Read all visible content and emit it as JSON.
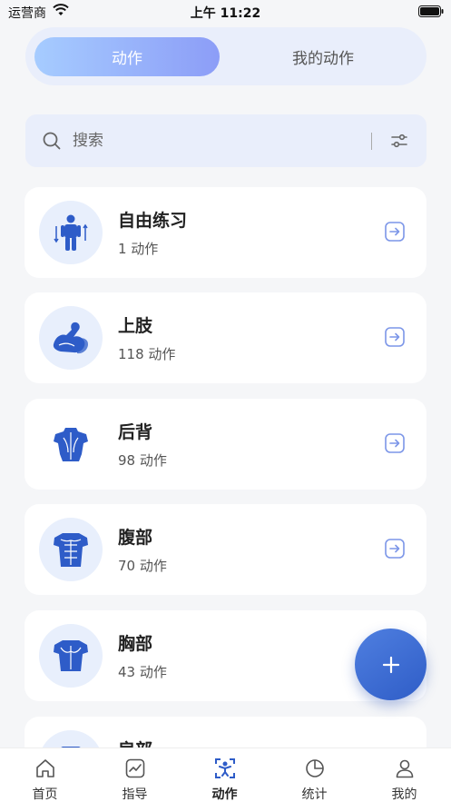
{
  "status_bar": {
    "carrier": "运营商",
    "time": "上午 11:22"
  },
  "segmented": {
    "active_label": "动作",
    "inactive_label": "我的动作"
  },
  "search": {
    "placeholder": "搜索"
  },
  "categories": [
    {
      "title": "自由练习",
      "count": "1 动作",
      "icon": "standing-person-icon"
    },
    {
      "title": "上肢",
      "count": "118 动作",
      "icon": "flexed-arm-icon"
    },
    {
      "title": "后背",
      "count": "98 动作",
      "icon": "back-muscles-icon"
    },
    {
      "title": "腹部",
      "count": "70 动作",
      "icon": "abs-muscles-icon"
    },
    {
      "title": "胸部",
      "count": "43 动作",
      "icon": "chest-muscles-icon"
    },
    {
      "title": "肩部",
      "count": "",
      "icon": "shoulder-muscles-icon"
    }
  ],
  "tabbar": {
    "items": [
      {
        "label": "首页",
        "icon": "home-icon"
      },
      {
        "label": "指导",
        "icon": "chart-icon"
      },
      {
        "label": "动作",
        "icon": "exercise-icon"
      },
      {
        "label": "统计",
        "icon": "pie-chart-icon"
      },
      {
        "label": "我的",
        "icon": "user-icon"
      }
    ],
    "active_index": 2
  },
  "colors": {
    "accent": "#2f5dc7",
    "icon_blue": "#2e5cc8",
    "segment_bg": "#e9eefb",
    "arrow": "#7c96e8"
  }
}
